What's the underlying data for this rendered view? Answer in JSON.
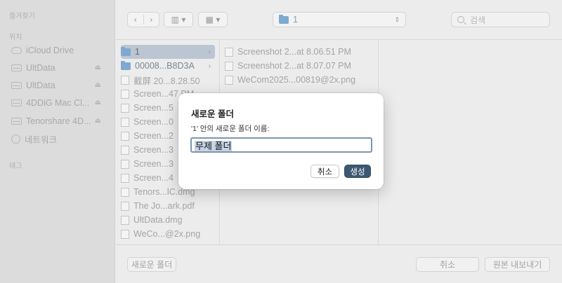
{
  "sidebar": {
    "favorites_header": "즐겨찾기",
    "locations_header": "위치",
    "tags_header": "태그",
    "items": [
      {
        "label": "iCloud Drive",
        "icon": "cloud-icon",
        "eject": false
      },
      {
        "label": "UltData",
        "icon": "disk-icon",
        "eject": true
      },
      {
        "label": "UltData",
        "icon": "disk-icon",
        "eject": true
      },
      {
        "label": "4DDiG Mac Cl...",
        "icon": "disk-icon",
        "eject": true
      },
      {
        "label": "Tenorshare 4D...",
        "icon": "disk-icon",
        "eject": true
      },
      {
        "label": "네트워크",
        "icon": "globe-icon",
        "eject": false
      }
    ]
  },
  "toolbar": {
    "back": "‹",
    "forward": "›",
    "view_column": "▥ ▾",
    "view_grid": "▦ ▾",
    "path": "1",
    "search_placeholder": "검색"
  },
  "columns": {
    "col1": [
      {
        "name": "1",
        "kind": "folder",
        "selected": true
      },
      {
        "name": "00008...B8D3A",
        "kind": "folder",
        "selected": false
      },
      {
        "name": "截屏 20...8.28.50",
        "kind": "file"
      },
      {
        "name": "Screen...47 PM",
        "kind": "file"
      },
      {
        "name": "Screen...5",
        "kind": "file"
      },
      {
        "name": "Screen...0",
        "kind": "file"
      },
      {
        "name": "Screen...2",
        "kind": "file"
      },
      {
        "name": "Screen...3",
        "kind": "file"
      },
      {
        "name": "Screen...3",
        "kind": "file"
      },
      {
        "name": "Screen...4",
        "kind": "file"
      },
      {
        "name": "Tenors...lC.dmg",
        "kind": "file"
      },
      {
        "name": "The Jo...ark.pdf",
        "kind": "file"
      },
      {
        "name": "UltData.dmg",
        "kind": "file"
      },
      {
        "name": "WeCo...@2x.png",
        "kind": "file"
      }
    ],
    "col2": [
      {
        "name": "Screenshot 2...at 8.06.51 PM"
      },
      {
        "name": "Screenshot 2...at 8.07.07 PM"
      },
      {
        "name": "WeCom2025...00819@2x.png"
      }
    ]
  },
  "bottom": {
    "new_folder": "새로운 폴더",
    "cancel": "취소",
    "export": "원본 내보내기"
  },
  "dialog": {
    "title": "새로운 폴더",
    "label": "'1' 안의 새로운 폴더 이름:",
    "input_value": "무제 폴더",
    "cancel": "취소",
    "create": "생성"
  }
}
